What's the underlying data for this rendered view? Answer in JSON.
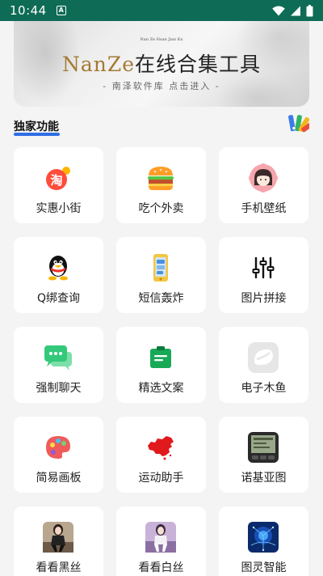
{
  "status": {
    "time": "10:44",
    "notification_glyph": "A"
  },
  "banner": {
    "small_text": "Nan Ze Hsan Jian Ku",
    "title_latin": "NanZe",
    "title_cjk": "在线合集工具",
    "subtitle": "- 南泽软件库 点击进入 -"
  },
  "section": {
    "title": "独家功能"
  },
  "items": [
    {
      "label": "实惠小街",
      "icon": "taobao-icon"
    },
    {
      "label": "吃个外卖",
      "icon": "burger-icon"
    },
    {
      "label": "手机壁纸",
      "icon": "girl-avatar-icon"
    },
    {
      "label": "Q绑查询",
      "icon": "qq-penguin-icon"
    },
    {
      "label": "短信轰炸",
      "icon": "sms-phone-icon"
    },
    {
      "label": "图片拼接",
      "icon": "sliders-icon"
    },
    {
      "label": "强制聊天",
      "icon": "chat-bubbles-icon"
    },
    {
      "label": "精选文案",
      "icon": "clipboard-icon"
    },
    {
      "label": "电子木鱼",
      "icon": "wooden-fish-icon"
    },
    {
      "label": "简易画板",
      "icon": "paint-palette-icon"
    },
    {
      "label": "运动助手",
      "icon": "china-map-icon"
    },
    {
      "label": "诺基亚图",
      "icon": "nokia-phone-icon"
    },
    {
      "label": "看看黑丝",
      "icon": "photo-black-icon"
    },
    {
      "label": "看看白丝",
      "icon": "photo-white-icon"
    },
    {
      "label": "图灵智能",
      "icon": "ai-brain-icon"
    }
  ]
}
